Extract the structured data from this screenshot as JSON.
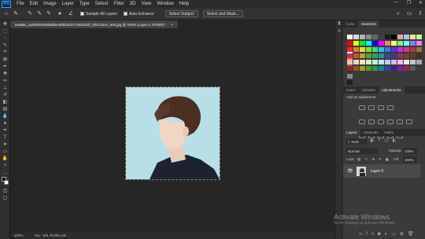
{
  "app": {
    "logo": "Ps"
  },
  "menu": [
    "File",
    "Edit",
    "Image",
    "Layer",
    "Type",
    "Select",
    "Filter",
    "3D",
    "View",
    "Window",
    "Help"
  ],
  "window_controls": [
    "—",
    "❐",
    "✕"
  ],
  "options": {
    "sample_all_layers": "Sample All Layers",
    "auto_enhance": "Auto-Enhance",
    "select_subject": "Select Subject",
    "select_and_mask": "Select and Mask..."
  },
  "document_tab": {
    "title": "5ea68c_ac9d0b4849b0d6e4d9b1632716822b4f_0hb134x4_500.jpg @ 100% (Layer 0, RGB/8) *",
    "close": "×"
  },
  "status": {
    "zoom": "100%",
    "doc": "Doc: 304.7K/351.5K"
  },
  "panels": {
    "color_tabs": [
      "Color",
      "Swatches"
    ],
    "adjust_tabs": [
      "Learn",
      "Libraries",
      "Adjustments"
    ],
    "add_adjustment": "Add an adjustment",
    "layer_tabs": [
      "Layers",
      "Channels",
      "Paths"
    ],
    "kind": "Kind",
    "blend_mode": "Normal",
    "opacity_label": "Opacity:",
    "opacity_value": "100%",
    "lock_label": "Lock:",
    "fill_label": "Fill:",
    "fill_value": "100%",
    "layer_name": "Layer 0"
  },
  "watermark": {
    "line1": "Activate Windows",
    "line2": "Go to Settings to activate Windows."
  },
  "colors": {
    "swatches_row1": [
      "#ffffff",
      "#d9d9d9",
      "#b3b3b3",
      "#8c8c8c",
      "#666666",
      "#404040",
      "#1a1a1a",
      "#000000",
      "#f2a0a0",
      "#a0c8f2",
      "#f2e0a0",
      "#c8f2a0",
      "#e6e6e6"
    ],
    "swatches_row2": [
      "#ff0000",
      "#ffff00",
      "#00ff00",
      "#00ffff",
      "#0000ff",
      "#ff00ff",
      "#ff8080",
      "#ffff80",
      "#80ff80",
      "#80ffff",
      "#8080ff",
      "#ff80ff",
      "#ff8000"
    ],
    "swatches_row3": [
      "#e03030",
      "#e08030",
      "#e0e030",
      "#80e030",
      "#30e080",
      "#30c0e0",
      "#3080e0",
      "#6030e0",
      "#c030e0",
      "#e03090",
      "#a04040",
      "#a07040",
      "#707070"
    ],
    "swatches_row4": [
      "#c03060",
      "#d05030",
      "#c0a030",
      "#60a030",
      "#30a060",
      "#3090a0",
      "#305090",
      "#503090",
      "#903070",
      "#804020",
      "#604020",
      "#403020",
      "#303030"
    ],
    "swatches_row5": [
      "#f0c0c0",
      "#f0d8c0",
      "#f0f0c0",
      "#d8f0c0",
      "#c0f0d8",
      "#c0e8f0",
      "#c0d0f0",
      "#d0c0f0",
      "#f0c0e8",
      "#e8e8e8",
      "#c8c8c8",
      "#a8a8a8",
      "#888888"
    ],
    "swatches_row6": [
      "#a02020",
      "#a05020",
      "#a0a020",
      "#50a020",
      "#20a050",
      "#2080a0",
      "#2050a0",
      "#4020a0",
      "#8020a0",
      "#a02060",
      "#5a5a5a",
      "#3c3c3c",
      "#1e1e1e"
    ]
  }
}
